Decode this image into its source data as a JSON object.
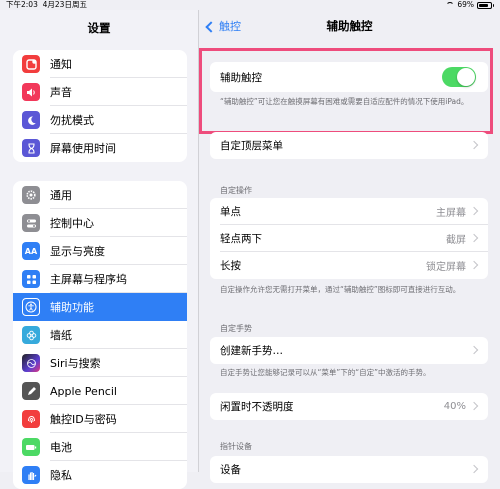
{
  "status": {
    "time": "下午2:03",
    "date": "4月23日周五",
    "battery": "69%"
  },
  "sidebar": {
    "title": "设置",
    "group1": [
      {
        "label": "通知",
        "icon": "notification-icon",
        "color": "#f23d3d"
      },
      {
        "label": "声音",
        "icon": "sound-icon",
        "color": "#f2385a"
      },
      {
        "label": "勿扰模式",
        "icon": "moon-icon",
        "color": "#5b57d6"
      },
      {
        "label": "屏幕使用时间",
        "icon": "hourglass-icon",
        "color": "#5b57d6"
      }
    ],
    "group2": [
      {
        "label": "通用",
        "icon": "gear-icon",
        "color": "#8e8e93"
      },
      {
        "label": "控制中心",
        "icon": "switches-icon",
        "color": "#8e8e93"
      },
      {
        "label": "显示与亮度",
        "icon": "display-icon",
        "color": "#2f7ff5",
        "glyph": "AA"
      },
      {
        "label": "主屏幕与程序坞",
        "icon": "grid-icon",
        "color": "#2f7ff5"
      },
      {
        "label": "辅助功能",
        "icon": "accessibility-icon",
        "color": "#2f7ff5",
        "selected": true
      },
      {
        "label": "墙纸",
        "icon": "flower-icon",
        "color": "#36aadc"
      },
      {
        "label": "Siri与搜索",
        "icon": "siri-icon",
        "color": "#222222"
      },
      {
        "label": "Apple Pencil",
        "icon": "pencil-icon",
        "color": "#555555"
      },
      {
        "label": "触控ID与密码",
        "icon": "fingerprint-icon",
        "color": "#f23d3d"
      },
      {
        "label": "电池",
        "icon": "battery-icon",
        "color": "#4cd964"
      },
      {
        "label": "隐私",
        "icon": "hand-icon",
        "color": "#2f7ff5"
      }
    ]
  },
  "nav": {
    "back_label": "触控",
    "title": "辅助触控"
  },
  "assistive": {
    "label": "辅助触控",
    "toggle_on": true,
    "footer": "“辅助触控”可让您在触摸屏幕有困难或需要自适应配件的情况下使用iPad。"
  },
  "top_menu": {
    "label": "自定顶层菜单"
  },
  "custom_actions": {
    "header": "自定操作",
    "rows": [
      {
        "label": "单点",
        "value": "主屏幕"
      },
      {
        "label": "轻点两下",
        "value": "截屏"
      },
      {
        "label": "长按",
        "value": "锁定屏幕"
      }
    ],
    "footer": "自定操作允许您无需打开菜单，通过“辅助触控”图标即可直接进行互动。"
  },
  "gestures": {
    "header": "自定手势",
    "create": "创建新手势…",
    "footer": "自定手势让您能够记录可以从“菜单”下的“自定”中激活的手势。"
  },
  "idle_opacity": {
    "label": "闲置时不透明度",
    "value": "40%"
  },
  "pointer_devices": {
    "header": "指针设备",
    "first_row": "设备"
  },
  "colors": {
    "accent": "#2f7ff5",
    "toggle_on": "#4cd964",
    "highlight": "#ee4c7c"
  }
}
